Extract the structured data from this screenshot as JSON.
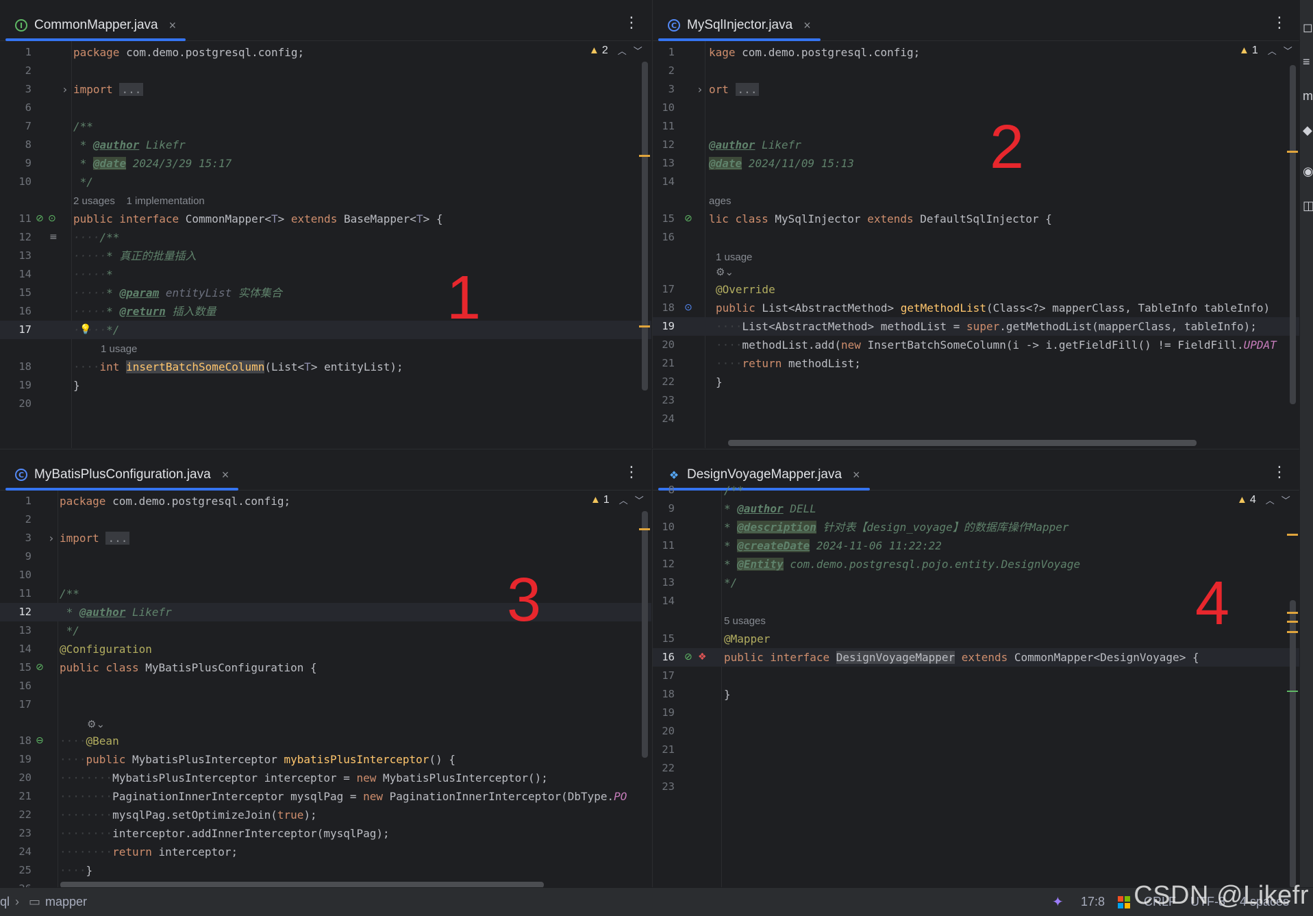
{
  "panes": [
    {
      "tab_title": "CommonMapper.java",
      "problems": "2",
      "big_label": "1"
    },
    {
      "tab_title": "MySqlInjector.java",
      "problems": "1",
      "big_label": "2"
    },
    {
      "tab_title": "MyBatisPlusConfiguration.java",
      "problems": "1",
      "big_label": "3"
    },
    {
      "tab_title": "DesignVoyageMapper.java",
      "problems": "4",
      "big_label": "4"
    }
  ],
  "icons": {
    "tab_kebab": "more-vertical-icon",
    "close": "close-icon",
    "warning": "warning-icon",
    "fold": "chevron-right-icon"
  },
  "colors": {
    "keyword": "#cf8e6d",
    "comment": "#5f826b",
    "annotation": "#b3ae60",
    "method": "#ffc66d",
    "field": "#c77dbb",
    "warning": "#f2c55c",
    "label_red": "#e8272d"
  },
  "statusbar": {
    "path_start": "ql",
    "path_folder": "mapper",
    "position": "17:8",
    "line_sep": "CRLF",
    "encoding": "UTF-8",
    "indent": "4 spaces"
  },
  "watermark": "CSDN @Likefr"
}
